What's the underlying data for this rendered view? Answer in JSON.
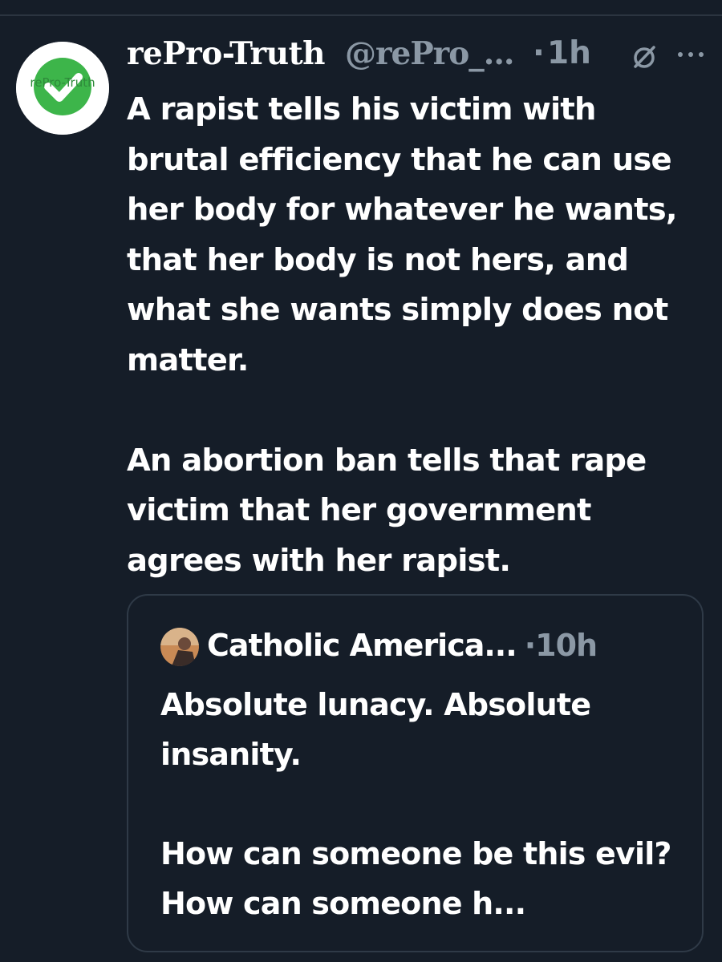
{
  "tweet": {
    "author_name": "rePro-Truth",
    "handle": "@rePro_...",
    "separator": "·",
    "time": "1h",
    "avatar_label": "rePro-Truth",
    "paragraphs": [
      "A rapist tells his victim with brutal efficiency that he can use her body for whatever he wants, that her body is not hers, and what she wants simply does not matter.",
      "An abortion ban tells that rape victim that her government agrees with her rapist."
    ]
  },
  "quoted_tweet": {
    "author_name": "Catholic America...",
    "separator": "·",
    "time": "10h",
    "paragraphs": [
      "Absolute lunacy. Absolute insanity.",
      "How can someone be this evil? How can someone h..."
    ]
  },
  "colors": {
    "background": "#151d28",
    "primary_text": "#ffffff",
    "secondary_text": "#8b98a5",
    "card_border": "#2f3a47",
    "avatar_accent": "#3db54a"
  },
  "icons": [
    "avatar-checkmark-icon",
    "grok-icon",
    "more-options-icon"
  ]
}
